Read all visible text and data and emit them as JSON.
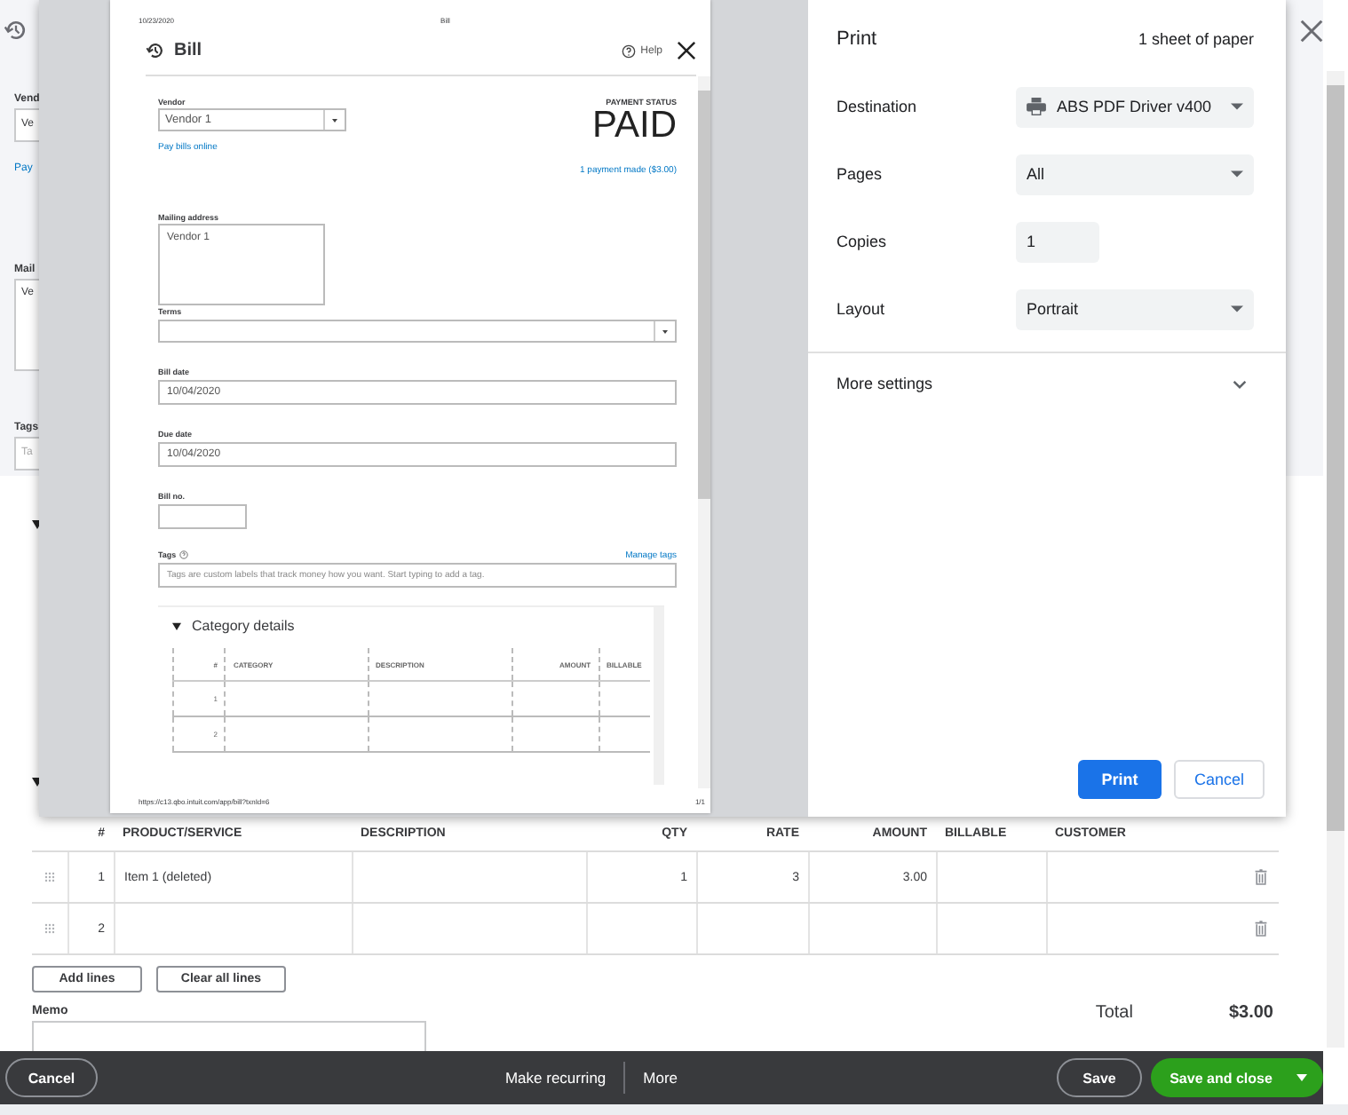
{
  "background_form": {
    "left_fragments": {
      "vendor_label": "Vend",
      "vendor_field": "Ve",
      "pay_link": "Pay",
      "mailing_label": "Mail",
      "mailing_field": "Ve",
      "tags_label": "Tags",
      "tags_field": "Ta"
    }
  },
  "print_preview": {
    "page_date": "10/23/2020",
    "page_title": "Bill",
    "bill": {
      "title": "Bill",
      "help": "Help",
      "vendor_label": "Vendor",
      "vendor": "Vendor 1",
      "pay_online": "Pay bills online",
      "payment_status_label": "PAYMENT STATUS",
      "payment_status": "PAID",
      "payments_link": "1 payment made ($3.00)",
      "mailing_label": "Mailing address",
      "mailing_address": "Vendor 1",
      "terms_label": "Terms",
      "bill_date_label": "Bill date",
      "bill_date": "10/04/2020",
      "due_date_label": "Due date",
      "due_date": "10/04/2020",
      "bill_no_label": "Bill no.",
      "tags_label": "Tags",
      "manage_tags": "Manage tags",
      "tags_placeholder": "Tags are custom labels that track money how you want. Start typing to add a tag.",
      "category_details": {
        "title": "Category details",
        "expanded": true,
        "columns": [
          "#",
          "CATEGORY",
          "DESCRIPTION",
          "AMOUNT",
          "BILLABLE"
        ],
        "rows": [
          {
            "number": "1"
          },
          {
            "number": "2"
          }
        ]
      }
    },
    "page_url": "https://c13.qbo.intuit.com/app/bill?txnId=6",
    "page_count": "1/1"
  },
  "print_settings": {
    "title": "Print",
    "sheets": "1 sheet of paper",
    "settings": [
      {
        "label": "Destination",
        "value": "ABS PDF Driver v400",
        "kind": "printer"
      },
      {
        "label": "Pages",
        "value": "All",
        "kind": "select"
      },
      {
        "label": "Copies",
        "value": "1",
        "kind": "number"
      },
      {
        "label": "Layout",
        "value": "Portrait",
        "kind": "select"
      }
    ],
    "more_settings": "More settings",
    "buttons": {
      "print": "Print",
      "cancel": "Cancel"
    }
  },
  "items_table": {
    "columns": [
      "#",
      "PRODUCT/SERVICE",
      "DESCRIPTION",
      "QTY",
      "RATE",
      "AMOUNT",
      "BILLABLE",
      "CUSTOMER"
    ],
    "rows": [
      {
        "number": "1",
        "product_service": "Item 1 (deleted)",
        "qty": "1",
        "rate": "3",
        "amount": "3.00"
      },
      {
        "number": "2"
      }
    ]
  },
  "line_buttons": [
    "Add lines",
    "Clear all lines"
  ],
  "memo_label": "Memo",
  "total_label": "Total",
  "total_value": "$3.00",
  "footer": {
    "cancel": "Cancel",
    "make_recurring": "Make recurring",
    "more": "More",
    "save": "Save",
    "save_and_close": "Save and close"
  }
}
